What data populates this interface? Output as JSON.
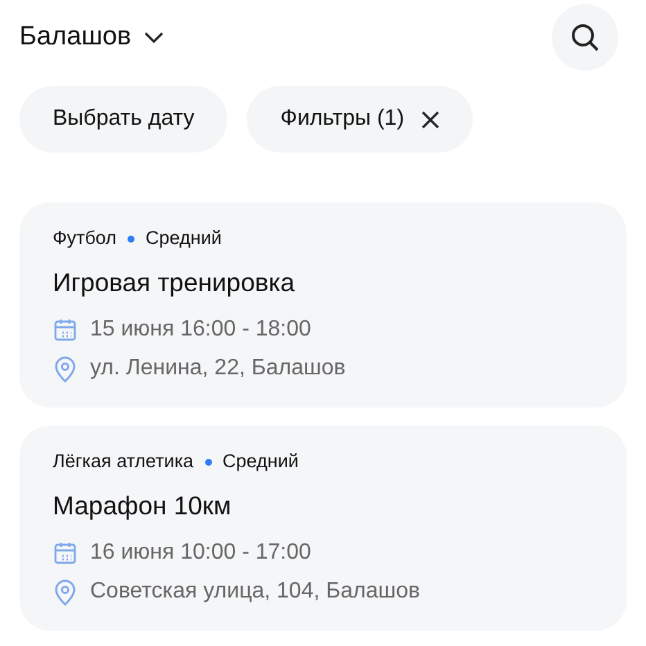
{
  "header": {
    "city": "Балашов"
  },
  "chips": [
    {
      "label": "Выбрать дату",
      "kind": "plain"
    },
    {
      "label": "Фильтры (1)",
      "kind": "clearable"
    }
  ],
  "events": [
    {
      "sport": "Футбол",
      "level_label": "Средний",
      "title": "Игровая тренировка",
      "date": "15 июня 16:00 - 18:00",
      "address": "ул. Ленина, 22, Балашов"
    },
    {
      "sport": "Лёгкая атлетика",
      "level_label": "Средний",
      "title": "Марафон 10км",
      "date": "16 июня 10:00 - 17:00",
      "address": "Советская улица, 104, Балашов"
    }
  ]
}
